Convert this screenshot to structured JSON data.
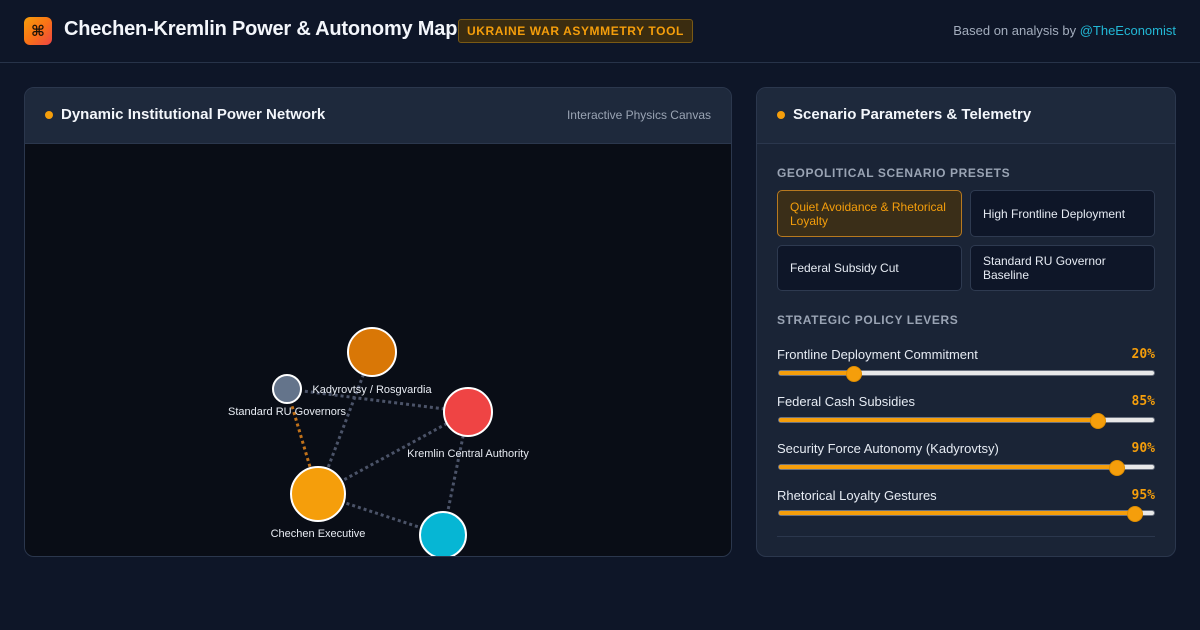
{
  "header": {
    "logo_glyph": "⌘",
    "title": "Chechen-Kremlin Power & Autonomy Map",
    "badge": "UKRAINE WAR ASYMMETRY TOOL",
    "credit_prefix": "Based on analysis by",
    "credit_handle": "@TheEconomist"
  },
  "network_panel": {
    "title": "Dynamic Institutional Power Network",
    "subtitle": "Interactive Physics Canvas",
    "nodes": [
      {
        "id": "kadyrovtsy",
        "label": "Kadyrovtsy / Rosgvardia",
        "color": "#d97706"
      },
      {
        "id": "governors",
        "label": "Standard RU Governors",
        "color": "#64748b"
      },
      {
        "id": "kremlin",
        "label": "Kremlin Central Authority",
        "color": "#ef4444"
      },
      {
        "id": "chechen",
        "label": "Chechen Executive",
        "color": "#f59e0b"
      },
      {
        "id": "fifth",
        "label": "",
        "color": "#06b6d4"
      }
    ]
  },
  "scenario_panel": {
    "title": "Scenario Parameters & Telemetry",
    "presets_heading": "GEOPOLITICAL SCENARIO PRESETS",
    "presets": [
      {
        "label": "Quiet Avoidance & Rhetorical Loyalty",
        "active": true
      },
      {
        "label": "High Frontline Deployment",
        "active": false
      },
      {
        "label": "Federal Subsidy Cut",
        "active": false
      },
      {
        "label": "Standard RU Governor Baseline",
        "active": false
      }
    ],
    "levers_heading": "STRATEGIC POLICY LEVERS",
    "levers": [
      {
        "label": "Frontline Deployment Commitment",
        "value": 20,
        "display": "20%"
      },
      {
        "label": "Federal Cash Subsidies",
        "value": 85,
        "display": "85%"
      },
      {
        "label": "Security Force Autonomy (Kadyrovtsy)",
        "value": 90,
        "display": "90%"
      },
      {
        "label": "Rhetorical Loyalty Gestures",
        "value": 95,
        "display": "95%"
      }
    ]
  },
  "colors": {
    "accent": "#f59e0b",
    "background": "#0e1628",
    "panel": "#1a2436",
    "link": "#22b8d6"
  }
}
